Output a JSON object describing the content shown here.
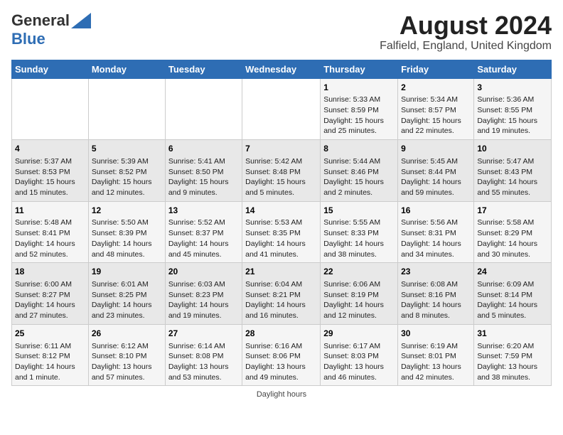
{
  "header": {
    "logo_general": "General",
    "logo_blue": "Blue",
    "month_title": "August 2024",
    "location": "Falfield, England, United Kingdom"
  },
  "footer": {
    "daylight_label": "Daylight hours"
  },
  "days_of_week": [
    "Sunday",
    "Monday",
    "Tuesday",
    "Wednesday",
    "Thursday",
    "Friday",
    "Saturday"
  ],
  "weeks": [
    [
      {
        "day": "",
        "info": ""
      },
      {
        "day": "",
        "info": ""
      },
      {
        "day": "",
        "info": ""
      },
      {
        "day": "",
        "info": ""
      },
      {
        "day": "1",
        "info": "Sunrise: 5:33 AM\nSunset: 8:59 PM\nDaylight: 15 hours\nand 25 minutes."
      },
      {
        "day": "2",
        "info": "Sunrise: 5:34 AM\nSunset: 8:57 PM\nDaylight: 15 hours\nand 22 minutes."
      },
      {
        "day": "3",
        "info": "Sunrise: 5:36 AM\nSunset: 8:55 PM\nDaylight: 15 hours\nand 19 minutes."
      }
    ],
    [
      {
        "day": "4",
        "info": "Sunrise: 5:37 AM\nSunset: 8:53 PM\nDaylight: 15 hours\nand 15 minutes."
      },
      {
        "day": "5",
        "info": "Sunrise: 5:39 AM\nSunset: 8:52 PM\nDaylight: 15 hours\nand 12 minutes."
      },
      {
        "day": "6",
        "info": "Sunrise: 5:41 AM\nSunset: 8:50 PM\nDaylight: 15 hours\nand 9 minutes."
      },
      {
        "day": "7",
        "info": "Sunrise: 5:42 AM\nSunset: 8:48 PM\nDaylight: 15 hours\nand 5 minutes."
      },
      {
        "day": "8",
        "info": "Sunrise: 5:44 AM\nSunset: 8:46 PM\nDaylight: 15 hours\nand 2 minutes."
      },
      {
        "day": "9",
        "info": "Sunrise: 5:45 AM\nSunset: 8:44 PM\nDaylight: 14 hours\nand 59 minutes."
      },
      {
        "day": "10",
        "info": "Sunrise: 5:47 AM\nSunset: 8:43 PM\nDaylight: 14 hours\nand 55 minutes."
      }
    ],
    [
      {
        "day": "11",
        "info": "Sunrise: 5:48 AM\nSunset: 8:41 PM\nDaylight: 14 hours\nand 52 minutes."
      },
      {
        "day": "12",
        "info": "Sunrise: 5:50 AM\nSunset: 8:39 PM\nDaylight: 14 hours\nand 48 minutes."
      },
      {
        "day": "13",
        "info": "Sunrise: 5:52 AM\nSunset: 8:37 PM\nDaylight: 14 hours\nand 45 minutes."
      },
      {
        "day": "14",
        "info": "Sunrise: 5:53 AM\nSunset: 8:35 PM\nDaylight: 14 hours\nand 41 minutes."
      },
      {
        "day": "15",
        "info": "Sunrise: 5:55 AM\nSunset: 8:33 PM\nDaylight: 14 hours\nand 38 minutes."
      },
      {
        "day": "16",
        "info": "Sunrise: 5:56 AM\nSunset: 8:31 PM\nDaylight: 14 hours\nand 34 minutes."
      },
      {
        "day": "17",
        "info": "Sunrise: 5:58 AM\nSunset: 8:29 PM\nDaylight: 14 hours\nand 30 minutes."
      }
    ],
    [
      {
        "day": "18",
        "info": "Sunrise: 6:00 AM\nSunset: 8:27 PM\nDaylight: 14 hours\nand 27 minutes."
      },
      {
        "day": "19",
        "info": "Sunrise: 6:01 AM\nSunset: 8:25 PM\nDaylight: 14 hours\nand 23 minutes."
      },
      {
        "day": "20",
        "info": "Sunrise: 6:03 AM\nSunset: 8:23 PM\nDaylight: 14 hours\nand 19 minutes."
      },
      {
        "day": "21",
        "info": "Sunrise: 6:04 AM\nSunset: 8:21 PM\nDaylight: 14 hours\nand 16 minutes."
      },
      {
        "day": "22",
        "info": "Sunrise: 6:06 AM\nSunset: 8:19 PM\nDaylight: 14 hours\nand 12 minutes."
      },
      {
        "day": "23",
        "info": "Sunrise: 6:08 AM\nSunset: 8:16 PM\nDaylight: 14 hours\nand 8 minutes."
      },
      {
        "day": "24",
        "info": "Sunrise: 6:09 AM\nSunset: 8:14 PM\nDaylight: 14 hours\nand 5 minutes."
      }
    ],
    [
      {
        "day": "25",
        "info": "Sunrise: 6:11 AM\nSunset: 8:12 PM\nDaylight: 14 hours\nand 1 minute."
      },
      {
        "day": "26",
        "info": "Sunrise: 6:12 AM\nSunset: 8:10 PM\nDaylight: 13 hours\nand 57 minutes."
      },
      {
        "day": "27",
        "info": "Sunrise: 6:14 AM\nSunset: 8:08 PM\nDaylight: 13 hours\nand 53 minutes."
      },
      {
        "day": "28",
        "info": "Sunrise: 6:16 AM\nSunset: 8:06 PM\nDaylight: 13 hours\nand 49 minutes."
      },
      {
        "day": "29",
        "info": "Sunrise: 6:17 AM\nSunset: 8:03 PM\nDaylight: 13 hours\nand 46 minutes."
      },
      {
        "day": "30",
        "info": "Sunrise: 6:19 AM\nSunset: 8:01 PM\nDaylight: 13 hours\nand 42 minutes."
      },
      {
        "day": "31",
        "info": "Sunrise: 6:20 AM\nSunset: 7:59 PM\nDaylight: 13 hours\nand 38 minutes."
      }
    ]
  ]
}
